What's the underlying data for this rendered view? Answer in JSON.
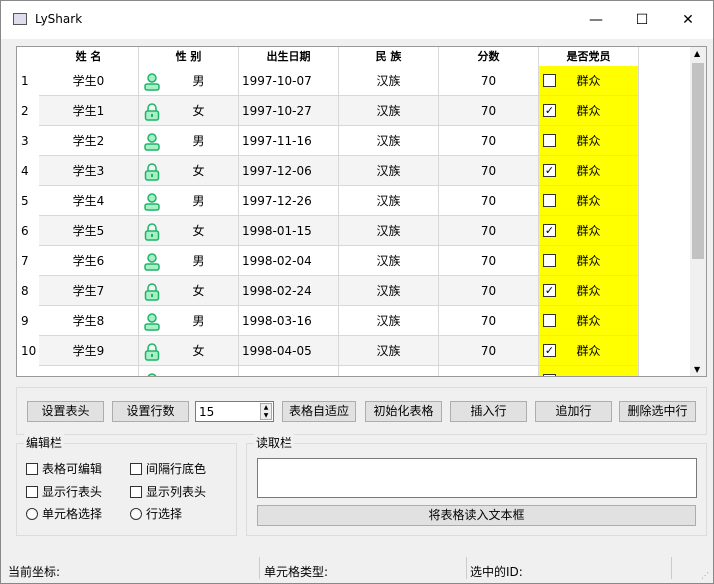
{
  "window": {
    "title": "LyShark",
    "minimize": "—",
    "maximize": "☐",
    "close": "✕"
  },
  "table": {
    "headers": [
      "姓 名",
      "性 别",
      "出生日期",
      "民 族",
      "分数",
      "是否党员"
    ],
    "rows": [
      {
        "num": "1",
        "name": "学生0",
        "gender": "男",
        "icon": "user",
        "birth": "1997-10-07",
        "ethnic": "汉族",
        "score": "70",
        "checked": false,
        "party": "群众"
      },
      {
        "num": "2",
        "name": "学生1",
        "gender": "女",
        "icon": "lock",
        "birth": "1997-10-27",
        "ethnic": "汉族",
        "score": "70",
        "checked": true,
        "party": "群众"
      },
      {
        "num": "3",
        "name": "学生2",
        "gender": "男",
        "icon": "user",
        "birth": "1997-11-16",
        "ethnic": "汉族",
        "score": "70",
        "checked": false,
        "party": "群众"
      },
      {
        "num": "4",
        "name": "学生3",
        "gender": "女",
        "icon": "lock",
        "birth": "1997-12-06",
        "ethnic": "汉族",
        "score": "70",
        "checked": true,
        "party": "群众"
      },
      {
        "num": "5",
        "name": "学生4",
        "gender": "男",
        "icon": "user",
        "birth": "1997-12-26",
        "ethnic": "汉族",
        "score": "70",
        "checked": false,
        "party": "群众"
      },
      {
        "num": "6",
        "name": "学生5",
        "gender": "女",
        "icon": "lock",
        "birth": "1998-01-15",
        "ethnic": "汉族",
        "score": "70",
        "checked": true,
        "party": "群众"
      },
      {
        "num": "7",
        "name": "学生6",
        "gender": "男",
        "icon": "user",
        "birth": "1998-02-04",
        "ethnic": "汉族",
        "score": "70",
        "checked": false,
        "party": "群众"
      },
      {
        "num": "8",
        "name": "学生7",
        "gender": "女",
        "icon": "lock",
        "birth": "1998-02-24",
        "ethnic": "汉族",
        "score": "70",
        "checked": true,
        "party": "群众"
      },
      {
        "num": "9",
        "name": "学生8",
        "gender": "男",
        "icon": "user",
        "birth": "1998-03-16",
        "ethnic": "汉族",
        "score": "70",
        "checked": false,
        "party": "群众"
      },
      {
        "num": "10",
        "name": "学生9",
        "gender": "女",
        "icon": "lock",
        "birth": "1998-04-05",
        "ethnic": "汉族",
        "score": "70",
        "checked": true,
        "party": "群众"
      }
    ]
  },
  "toolbar": {
    "set_header": "设置表头",
    "set_rows": "设置行数",
    "rows_value": "15",
    "autofit": "表格自适应",
    "init": "初始化表格",
    "insert": "插入行",
    "append": "追加行",
    "delete": "删除选中行"
  },
  "edit": {
    "title": "编辑栏",
    "editable": "表格可编辑",
    "alt_color": "间隔行底色",
    "show_row_header": "显示行表头",
    "show_col_header": "显示列表头",
    "cell_select": "单元格选择",
    "row_select": "行选择"
  },
  "read": {
    "title": "读取栏",
    "text": "",
    "button": "将表格读入文本框"
  },
  "status": {
    "coord": "当前坐标:",
    "cell_type": "单元格类型:",
    "selected_id": "选中的ID:"
  },
  "colors": {
    "party_bg": "#ffff00",
    "icon_green": "#2ecc71"
  }
}
